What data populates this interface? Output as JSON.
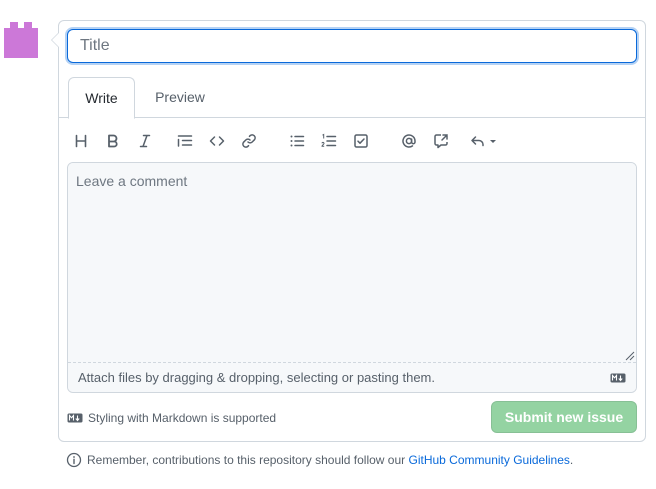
{
  "avatar": {
    "icon": "identicon-avatar",
    "color": "#cc78d8"
  },
  "form": {
    "title_placeholder": "Title",
    "title_value": "",
    "accent": "#0969da"
  },
  "tabs": [
    {
      "label": "Write",
      "selected": true
    },
    {
      "label": "Preview",
      "selected": false
    }
  ],
  "toolbar": {
    "items": [
      {
        "icon": "heading-icon"
      },
      {
        "icon": "bold-icon"
      },
      {
        "icon": "italic-icon"
      },
      {
        "icon": "quote-icon"
      },
      {
        "icon": "code-icon"
      },
      {
        "icon": "link-icon"
      },
      {
        "icon": "bulleted-list-icon"
      },
      {
        "icon": "numbered-list-icon"
      },
      {
        "icon": "task-list-icon"
      },
      {
        "icon": "mention-icon"
      },
      {
        "icon": "cross-reference-icon"
      },
      {
        "icon": "saved-replies-icon"
      }
    ]
  },
  "editor": {
    "placeholder": "Leave a comment",
    "value": "",
    "attach_text": "Attach files by dragging & dropping, selecting or pasting them."
  },
  "footer": {
    "markdown_note": "Styling with Markdown is supported",
    "submit_label": "Submit new issue",
    "submit_color": "#94d3a2"
  },
  "guidelines": {
    "prefix": "Remember, contributions to this repository should follow our",
    "link": "GitHub Community Guidelines",
    "suffix": "."
  }
}
